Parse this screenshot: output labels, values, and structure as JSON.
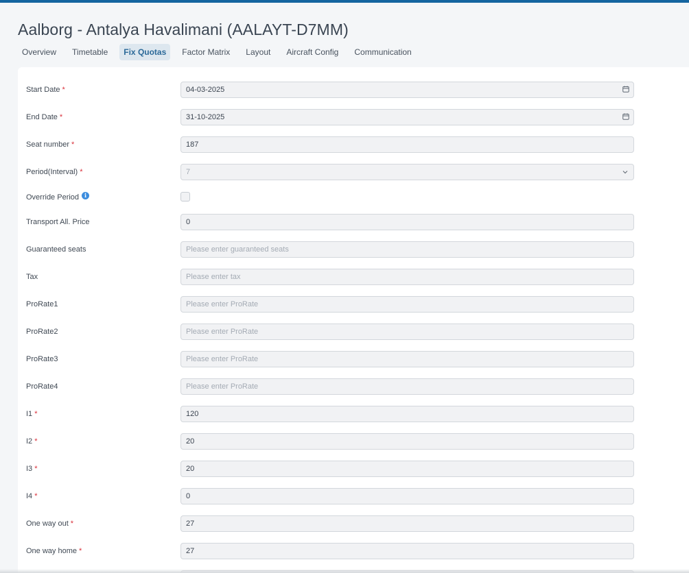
{
  "page": {
    "title": "Aalborg - Antalya Havalimani (AALAYT-D7MM)"
  },
  "tabs": [
    {
      "label": "Overview",
      "active": false
    },
    {
      "label": "Timetable",
      "active": false
    },
    {
      "label": "Fix Quotas",
      "active": true
    },
    {
      "label": "Factor Matrix",
      "active": false
    },
    {
      "label": "Layout",
      "active": false
    },
    {
      "label": "Aircraft Config",
      "active": false
    },
    {
      "label": "Communication",
      "active": false
    }
  ],
  "form": {
    "required_marker": "*",
    "start_date": {
      "label": "Start Date",
      "value": "04-03-2025"
    },
    "end_date": {
      "label": "End Date",
      "value": "31-10-2025"
    },
    "seat_number": {
      "label": "Seat number",
      "value": "187"
    },
    "period": {
      "label": "Period(Interval)",
      "value": "7"
    },
    "override_period": {
      "label": "Override Period",
      "checked": false
    },
    "transport_price": {
      "label": "Transport All. Price",
      "value": "0"
    },
    "guaranteed_seats": {
      "label": "Guaranteed seats",
      "value": "",
      "placeholder": "Please enter guaranteed seats"
    },
    "tax": {
      "label": "Tax",
      "value": "",
      "placeholder": "Please enter tax"
    },
    "prorate1": {
      "label": "ProRate1",
      "value": "",
      "placeholder": "Please enter ProRate"
    },
    "prorate2": {
      "label": "ProRate2",
      "value": "",
      "placeholder": "Please enter ProRate"
    },
    "prorate3": {
      "label": "ProRate3",
      "value": "",
      "placeholder": "Please enter ProRate"
    },
    "prorate4": {
      "label": "ProRate4",
      "value": "",
      "placeholder": "Please enter ProRate"
    },
    "i1": {
      "label": "I1",
      "value": "120"
    },
    "i2": {
      "label": "I2",
      "value": "20"
    },
    "i3": {
      "label": "I3",
      "value": "20"
    },
    "i4": {
      "label": "I4",
      "value": "0"
    },
    "one_way_out": {
      "label": "One way out",
      "value": "27"
    },
    "one_way_home": {
      "label": "One way home",
      "value": "27"
    }
  },
  "icons": {
    "calendar": "calendar-icon",
    "chevron": "chevron-down-icon",
    "info": "info-icon"
  },
  "colors": {
    "accent": "#1565a0",
    "active_tab_bg": "#dde7ef",
    "active_tab_text": "#2c6a99",
    "required": "#d9303a",
    "info": "#3c8dde"
  }
}
